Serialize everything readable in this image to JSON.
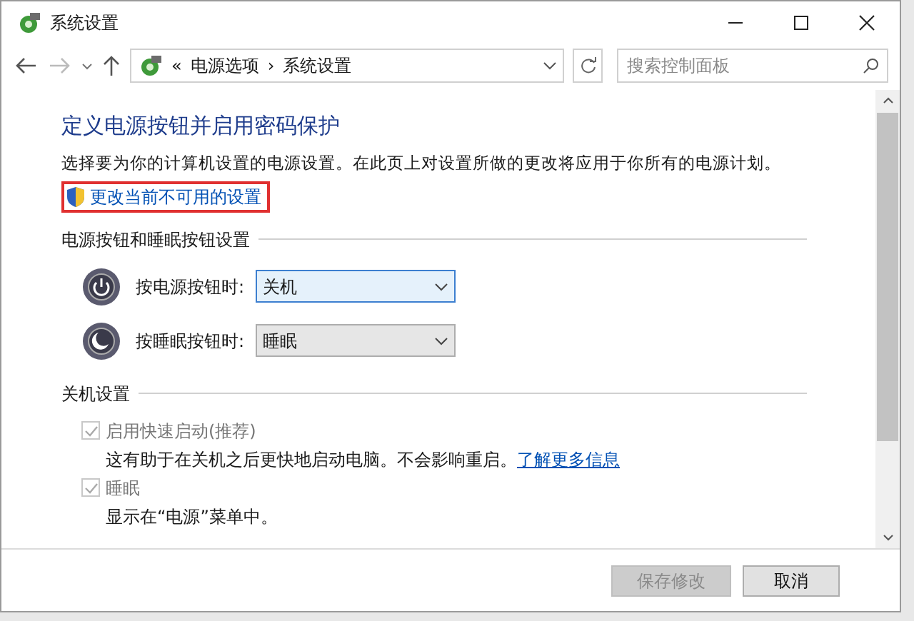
{
  "window": {
    "title": "系统设置"
  },
  "address_bar": {
    "breadcrumbs": [
      "«",
      "电源选项",
      "›",
      "系统设置"
    ]
  },
  "search": {
    "placeholder": "搜索控制面板"
  },
  "heading": "定义电源按钮并启用密码保护",
  "description": "选择要为你的计算机设置的电源设置。在此页上对设置所做的更改将应用于你所有的电源计划。",
  "admin_link": {
    "label": "更改当前不可用的设置",
    "highlighted": true
  },
  "button_section": {
    "title": "电源按钮和睡眠按钮设置",
    "rows": [
      {
        "kind": "power",
        "label": "按电源按钮时:",
        "value": "关机",
        "focused": true
      },
      {
        "kind": "sleep",
        "label": "按睡眠按钮时:",
        "value": "睡眠",
        "focused": false
      }
    ]
  },
  "shutdown_section": {
    "title": "关机设置",
    "options": [
      {
        "label": "启用快速启动(推荐)",
        "checked": true,
        "disabled": true,
        "description": "这有助于在关机之后更快地启动电脑。不会影响重启。",
        "link": "了解更多信息"
      },
      {
        "label": "睡眠",
        "checked": true,
        "disabled": true,
        "description": "显示在“电源”菜单中。"
      }
    ]
  },
  "buttons": [
    {
      "label": "保存修改",
      "disabled": true
    },
    {
      "label": "取消",
      "disabled": false
    }
  ]
}
